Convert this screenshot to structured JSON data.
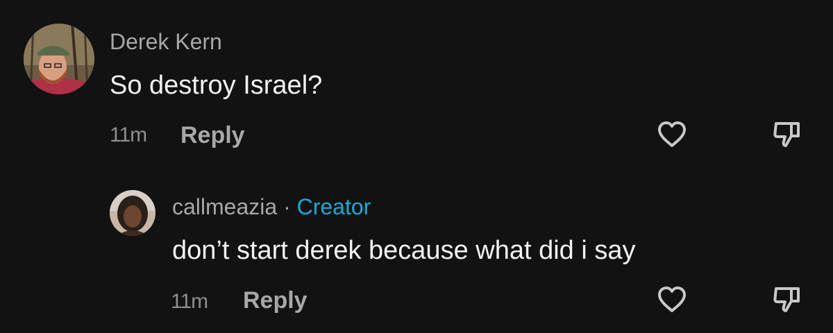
{
  "comments": [
    {
      "username": "Derek Kern",
      "text": "So destroy Israel?",
      "time": "11m",
      "reply_label": "Reply"
    },
    {
      "username": "callmeazia",
      "separator": "·",
      "badge": "Creator",
      "text": "don’t start derek because what did i say",
      "time": "11m",
      "reply_label": "Reply"
    }
  ],
  "colors": {
    "background": "#121212",
    "username": "#a8a8a8",
    "creator_badge": "#20a8d8",
    "body_text": "#f2f2f2"
  },
  "icons": {
    "like": "heart-outline-icon",
    "dislike": "thumbs-down-outline-icon"
  }
}
